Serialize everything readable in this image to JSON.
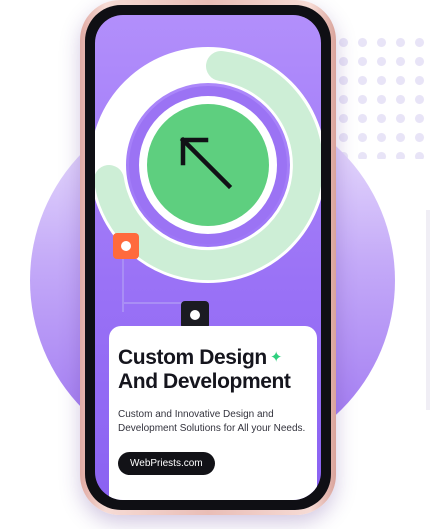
{
  "card": {
    "title_line1": "Custom Design",
    "title_line2": "And Development",
    "description": "Custom and Innovative Design and Development Solutions for All your Needs.",
    "cta_label": "WebPriests.com"
  },
  "icons": {
    "title_accent": "sparkle-icon",
    "hero": "arrow-up-left-icon"
  },
  "colors": {
    "accent_purple": "#9b73f4",
    "ring_green": "#cdeed6",
    "center_green": "#5ecf7f",
    "orange": "#ff6a3d",
    "sparkle_green": "#2fd07e",
    "dark": "#121217"
  }
}
